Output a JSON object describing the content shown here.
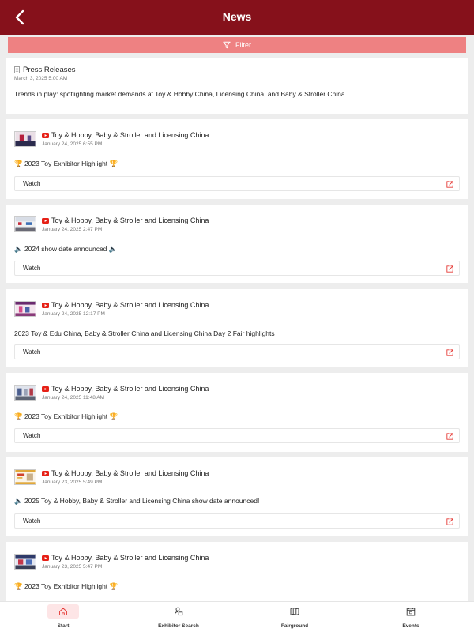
{
  "header": {
    "title": "News"
  },
  "filter": {
    "label": "Filter"
  },
  "press": {
    "title": "Press Releases",
    "date": "March 3, 2025 5:00 AM",
    "text": "Trends in play: spotlighting market demands at Toy & Hobby China, Licensing China, and Baby & Stroller China"
  },
  "posts": [
    {
      "source": "Toy & Hobby, Baby & Stroller and Licensing China",
      "date": "January 24, 2025 6:55 PM",
      "text": "🏆 2023 Toy Exhibitor Highlight 🏆",
      "watch": "Watch"
    },
    {
      "source": "Toy & Hobby, Baby & Stroller and Licensing China",
      "date": "January 24, 2025 2:47 PM",
      "text": "🔈 2024 show date announced 🔈",
      "watch": "Watch"
    },
    {
      "source": "Toy & Hobby, Baby & Stroller and Licensing China",
      "date": "January 24, 2025 12:17 PM",
      "text": "2023 Toy & Edu China, Baby & Stroller China and Licensing China Day 2 Fair highlights",
      "watch": "Watch"
    },
    {
      "source": "Toy & Hobby, Baby & Stroller and Licensing China",
      "date": "January 24, 2025 11:48 AM",
      "text": "🏆 2023 Toy Exhibitor Highlight 🏆",
      "watch": "Watch"
    },
    {
      "source": "Toy & Hobby, Baby & Stroller and Licensing China",
      "date": "January 23, 2025 5:49 PM",
      "text": "🔈 2025 Toy & Hobby, Baby & Stroller and Licensing China show date announced!",
      "watch": "Watch"
    },
    {
      "source": "Toy & Hobby, Baby & Stroller and Licensing China",
      "date": "January 23, 2025 5:47 PM",
      "text": "🏆 2023 Toy Exhibitor Highlight 🏆",
      "watch": "Watch"
    }
  ],
  "tabs": [
    {
      "label": "Start",
      "icon": "home-icon",
      "active": true
    },
    {
      "label": "Exhibitor Search",
      "icon": "exhibitor-search-icon",
      "active": false
    },
    {
      "label": "Fairground",
      "icon": "map-icon",
      "active": false
    },
    {
      "label": "Events",
      "icon": "calendar-icon",
      "active": false
    }
  ],
  "colors": {
    "header": "#86111b",
    "filter": "#ee8182",
    "accent": "#e53935",
    "youtube": "#e62117"
  }
}
